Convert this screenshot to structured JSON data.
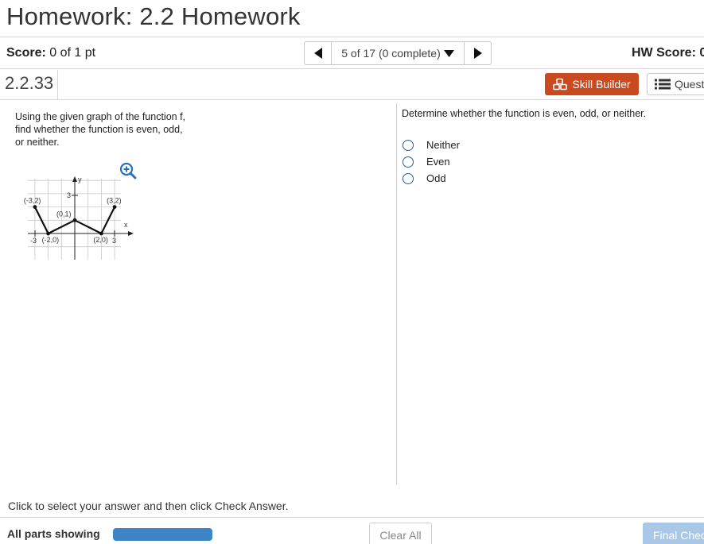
{
  "header": {
    "title": "Homework: 2.2 Homework"
  },
  "score": {
    "label": "Score:",
    "value": "0 of 1 pt"
  },
  "question_nav": {
    "selected": "5 of 17 (0 complete)"
  },
  "hw_score": {
    "label": "HW Score: 0"
  },
  "question": {
    "number": "2.2.33",
    "prompt": "Using the given graph of the function f, find whether the function is even, odd, or neither.",
    "text": "Determine whether the function is even, odd, or neither.",
    "choices": [
      "Neither",
      "Even",
      "Odd"
    ]
  },
  "toolbar": {
    "skill_builder": "Skill Builder",
    "question_help": "Quest"
  },
  "graph": {
    "y_axis": "y",
    "x_axis": "x",
    "tick_y3": "3",
    "tick_x3": "3",
    "tick_xneg3": "-3",
    "points": [
      {
        "label": "(-3,2)",
        "x": -3,
        "y": 2
      },
      {
        "label": "(-2,0)",
        "x": -2,
        "y": 0
      },
      {
        "label": "(0,1)",
        "x": 0,
        "y": 1
      },
      {
        "label": "(2,0)",
        "x": 2,
        "y": 0
      },
      {
        "label": "(3,2)",
        "x": 3,
        "y": 2
      }
    ]
  },
  "footer": {
    "instructions": "Click to select your answer and then click Check Answer.",
    "all_parts": "All parts showing",
    "clear_all": "Clear All",
    "final_check": "Final Chec"
  },
  "colors": {
    "skill_builder_bg": "#c94a1e",
    "progress": "#3d85c6",
    "radio_border": "#2c5d9a",
    "final_check_bg": "#a9c8e8"
  }
}
